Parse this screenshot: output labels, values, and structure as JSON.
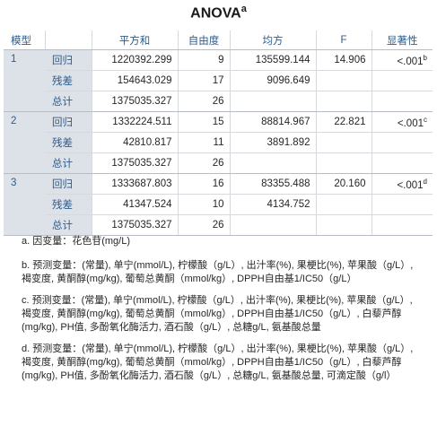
{
  "title": "ANOVA",
  "title_sup": "a",
  "headers": [
    "模型",
    "",
    "平方和",
    "自由度",
    "均方",
    "F",
    "显著性"
  ],
  "models": [
    {
      "id": "1",
      "rows": [
        {
          "label": "回归",
          "ss": "1220392.299",
          "df": "9",
          "ms": "135599.144",
          "f": "14.906",
          "sig": "<.001",
          "sig_sup": "b"
        },
        {
          "label": "残差",
          "ss": "154643.029",
          "df": "17",
          "ms": "9096.649",
          "f": "",
          "sig": "",
          "sig_sup": ""
        },
        {
          "label": "总计",
          "ss": "1375035.327",
          "df": "26",
          "ms": "",
          "f": "",
          "sig": "",
          "sig_sup": ""
        }
      ]
    },
    {
      "id": "2",
      "rows": [
        {
          "label": "回归",
          "ss": "1332224.511",
          "df": "15",
          "ms": "88814.967",
          "f": "22.821",
          "sig": "<.001",
          "sig_sup": "c"
        },
        {
          "label": "残差",
          "ss": "42810.817",
          "df": "11",
          "ms": "3891.892",
          "f": "",
          "sig": "",
          "sig_sup": ""
        },
        {
          "label": "总计",
          "ss": "1375035.327",
          "df": "26",
          "ms": "",
          "f": "",
          "sig": "",
          "sig_sup": ""
        }
      ]
    },
    {
      "id": "3",
      "rows": [
        {
          "label": "回归",
          "ss": "1333687.803",
          "df": "16",
          "ms": "83355.488",
          "f": "20.160",
          "sig": "<.001",
          "sig_sup": "d"
        },
        {
          "label": "残差",
          "ss": "41347.524",
          "df": "10",
          "ms": "4134.752",
          "f": "",
          "sig": "",
          "sig_sup": ""
        },
        {
          "label": "总计",
          "ss": "1375035.327",
          "df": "26",
          "ms": "",
          "f": "",
          "sig": "",
          "sig_sup": ""
        }
      ]
    }
  ],
  "notes": [
    "a. 因变量：花色苷(mg/L)",
    "b. 预测变量：(常量), 单宁(mmol/L), 柠檬酸（g/L）, 出汁率(%), 果梗比(%), 苹果酸（g/L）, 褐变度, 黄酮醇(mg/kg), 葡萄总黄酮（mmol/kg）, DPPH自由基1/IC50（g/L）",
    "c. 预测变量：(常量), 单宁(mmol/L), 柠檬酸（g/L）, 出汁率(%), 果梗比(%), 苹果酸（g/L）, 褐变度, 黄酮醇(mg/kg), 葡萄总黄酮（mmol/kg）, DPPH自由基1/IC50（g/L）, 白藜芦醇(mg/kg), PH值, 多酚氧化酶活力, 酒石酸（g/L）, 总糖g/L, 氨基酸总量",
    "d. 预测变量：(常量), 单宁(mmol/L), 柠檬酸（g/L）, 出汁率(%), 果梗比(%), 苹果酸（g/L）, 褐变度, 黄酮醇(mg/kg), 葡萄总黄酮（mmol/kg）, DPPH自由基1/IC50（g/L）, 白藜芦醇(mg/kg), PH值, 多酚氧化酶活力, 酒石酸（g/L）, 总糖g/L, 氨基酸总量, 可滴定酸（g/l）"
  ]
}
